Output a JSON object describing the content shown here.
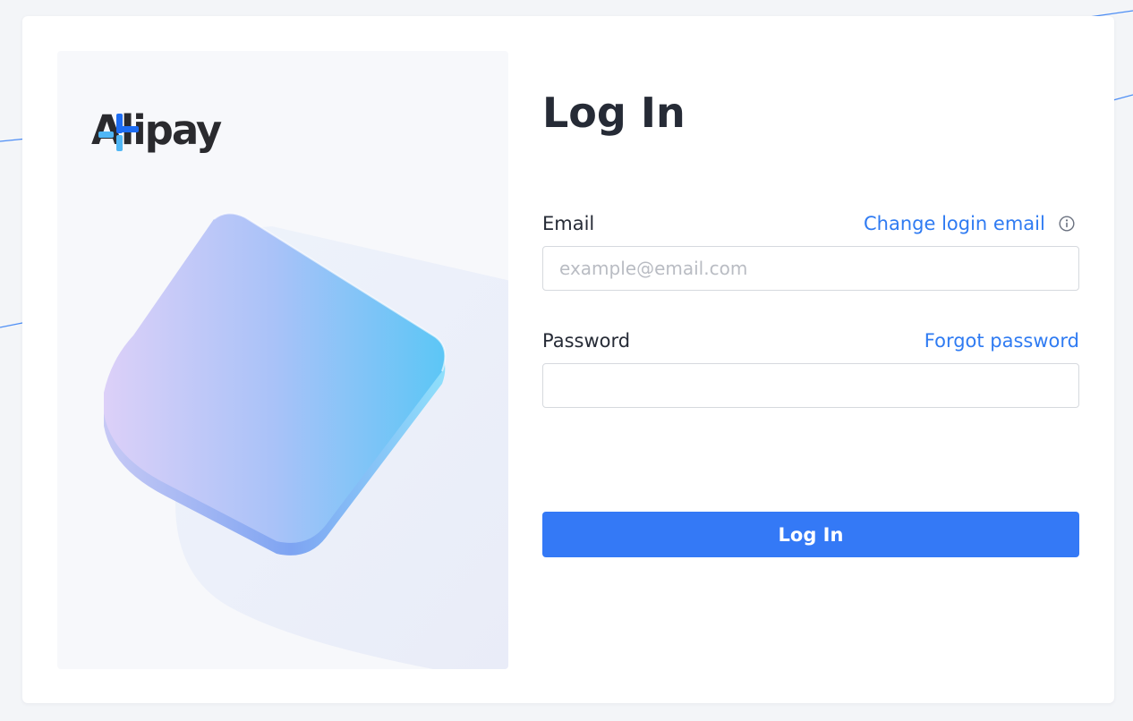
{
  "brand": {
    "name": "Alipay",
    "logo_mark": "plus-mark-icon",
    "colors": {
      "mark_dark": "#1d6cf2",
      "mark_light": "#4fb6f5",
      "text": "#2a2a2e"
    }
  },
  "hero": {
    "illustration": "glass-tile-illustration"
  },
  "login": {
    "title": "Log In",
    "email": {
      "label": "Email",
      "value": "",
      "placeholder": "example@email.com",
      "link_label": "Change login email",
      "info_icon": "info-icon"
    },
    "password": {
      "label": "Password",
      "value": "",
      "placeholder": "",
      "link_label": "Forgot password"
    },
    "submit_label": "Log In"
  },
  "colors": {
    "accent": "#3479f6",
    "link": "#2f7bf2",
    "page_bg": "#f3f5f8",
    "card_bg": "#ffffff",
    "text": "#262b36",
    "placeholder": "#b9bcc3",
    "input_border": "#d6d9de"
  }
}
